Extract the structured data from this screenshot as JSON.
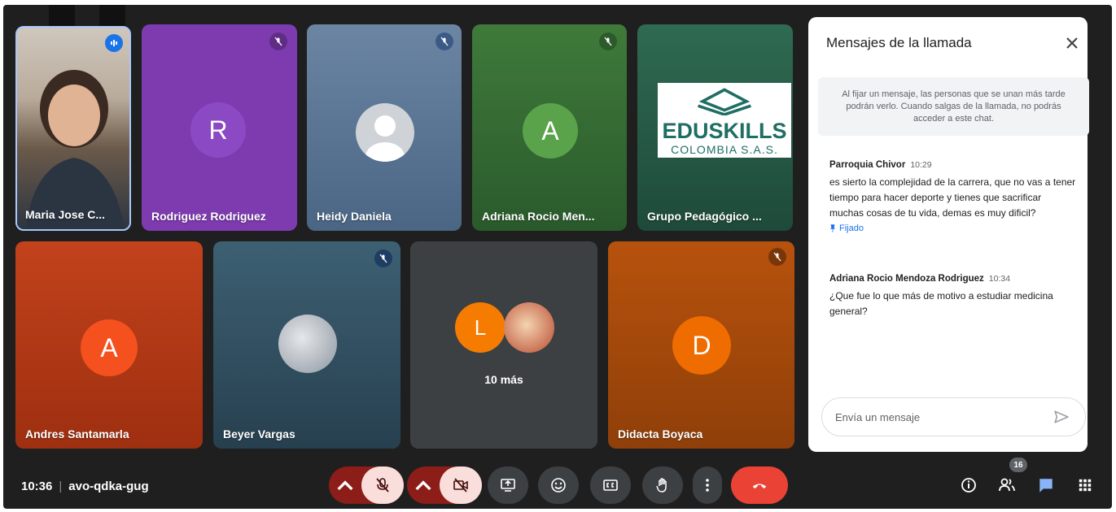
{
  "participants": [
    {
      "name": "Maria Jose C..."
    },
    {
      "name": "Rodriguez Rodriguez",
      "initial": "R"
    },
    {
      "name": "Heidy Daniela"
    },
    {
      "name": "Adriana Rocio Men...",
      "initial": "A"
    },
    {
      "name": "Grupo Pedagógico ..."
    },
    {
      "name": "Andres Santamarla",
      "initial": "A"
    },
    {
      "name": "Beyer Vargas"
    },
    {
      "initial": "L",
      "more_label": "10 más"
    },
    {
      "name": "Didacta Boyaca",
      "initial": "D"
    }
  ],
  "logo": {
    "line1": "EDUSKILLS",
    "line2": "COLOMBIA S.A.S."
  },
  "chat": {
    "title": "Mensajes de la llamada",
    "notice": "Al fijar un mensaje, las personas que se unan más tarde podrán verlo. Cuando salgas de la llamada, no podrás acceder a este chat.",
    "messages": [
      {
        "sender": "Parroquia Chivor",
        "time": "10:29",
        "text": "es sierto la complejidad de la carrera, que no vas a tener tiempo para hacer deporte y tienes que sacrificar muchas cosas de tu vida, demas es muy dificil?",
        "pinned_label": "Fijado"
      },
      {
        "sender": "Adriana Rocio Mendoza Rodriguez",
        "time": "10:34",
        "text": "¿Que fue lo que más de motivo a estudiar medicina general?"
      }
    ],
    "input_placeholder": "Envía un mensaje"
  },
  "meeting": {
    "time": "10:36",
    "code": "avo-qdka-gug"
  },
  "badges": {
    "people_count": "16"
  },
  "colors": {
    "end_call": "#ea4335",
    "mic_off_bg": "#f9dedc",
    "accent": "#8ab4f8"
  }
}
